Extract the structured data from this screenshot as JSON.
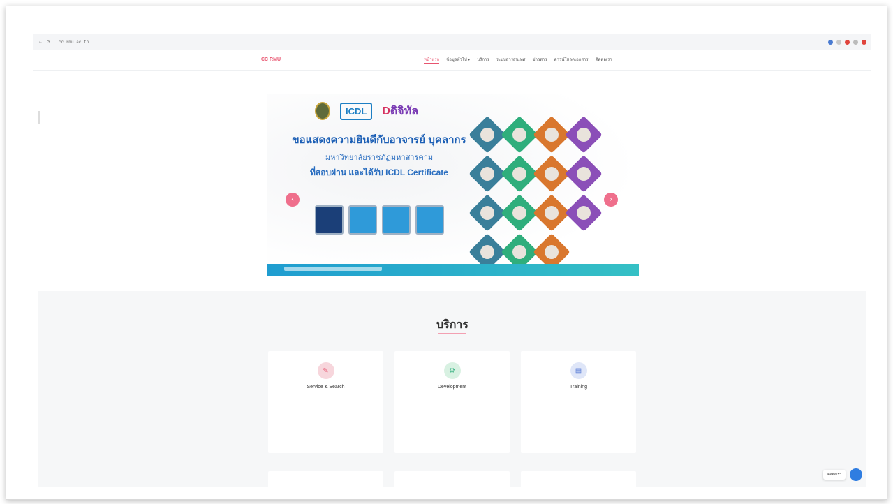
{
  "browser": {
    "url": "cc.rmu.ac.th",
    "nav_back": "←",
    "nav_reload": "⟳"
  },
  "site": {
    "logo_text": "CC RMU",
    "menu": [
      {
        "label": "หน้าแรก",
        "active": true
      },
      {
        "label": "ข้อมูลทั่วไป ▾"
      },
      {
        "label": "บริการ"
      },
      {
        "label": "ระบบสารสนเทศ"
      },
      {
        "label": "ข่าวสาร"
      },
      {
        "label": "ดาวน์โหลดเอกสาร"
      },
      {
        "label": "ติดต่อเรา"
      }
    ]
  },
  "banner": {
    "icdl_logo": "ICDL",
    "digital_logo": "ดิจิทัล",
    "headline": "ขอแสดงความยินดีกับอาจารย์ บุคลากร",
    "subhead": "มหาวิทยาลัยราชภัฏมหาสารคาม",
    "line3": "ที่สอบผ่าน และได้รับ ICDL Certificate",
    "prev": "‹",
    "next": "›"
  },
  "services": {
    "title": "บริการ",
    "cards": [
      {
        "title": "Service & Search",
        "icon": "wrench-icon",
        "color": "#f7d6dc"
      },
      {
        "title": "Development",
        "icon": "gear-icon",
        "color": "#d8f1e2"
      },
      {
        "title": "Training",
        "icon": "chart-icon",
        "color": "#dfe6f8"
      }
    ]
  },
  "chat": {
    "label": "ติดต่อเรา"
  }
}
